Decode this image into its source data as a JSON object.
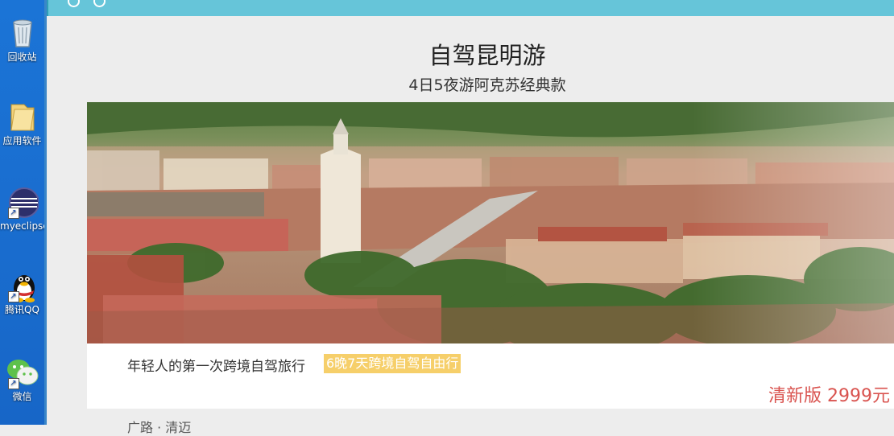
{
  "desktop": {
    "icons": [
      {
        "label": "回收站",
        "icon": "recycle-bin-icon"
      },
      {
        "label": "应用软件",
        "icon": "folder-icon"
      },
      {
        "label": "myeclipse...",
        "icon": "eclipse-icon"
      },
      {
        "label": "腾讯QQ",
        "icon": "qq-penguin-icon"
      },
      {
        "label": "微信",
        "icon": "wechat-icon"
      }
    ]
  },
  "page": {
    "title": "自驾昆明游",
    "subtitle": "4日5夜游阿克苏经典款",
    "hero_alt": "town-tilt-shift-photo",
    "tagline": "年轻人的第一次跨境自驾旅行",
    "badge": "6晚7天跨境自驾自由行",
    "price": "清新版 2999元",
    "cut_off_text": "广路 · 清迈"
  },
  "colors": {
    "topbar": "#66c5d9",
    "badge": "#f6cf6a",
    "price": "#d9534f",
    "desktop": "#1a6fd1"
  }
}
